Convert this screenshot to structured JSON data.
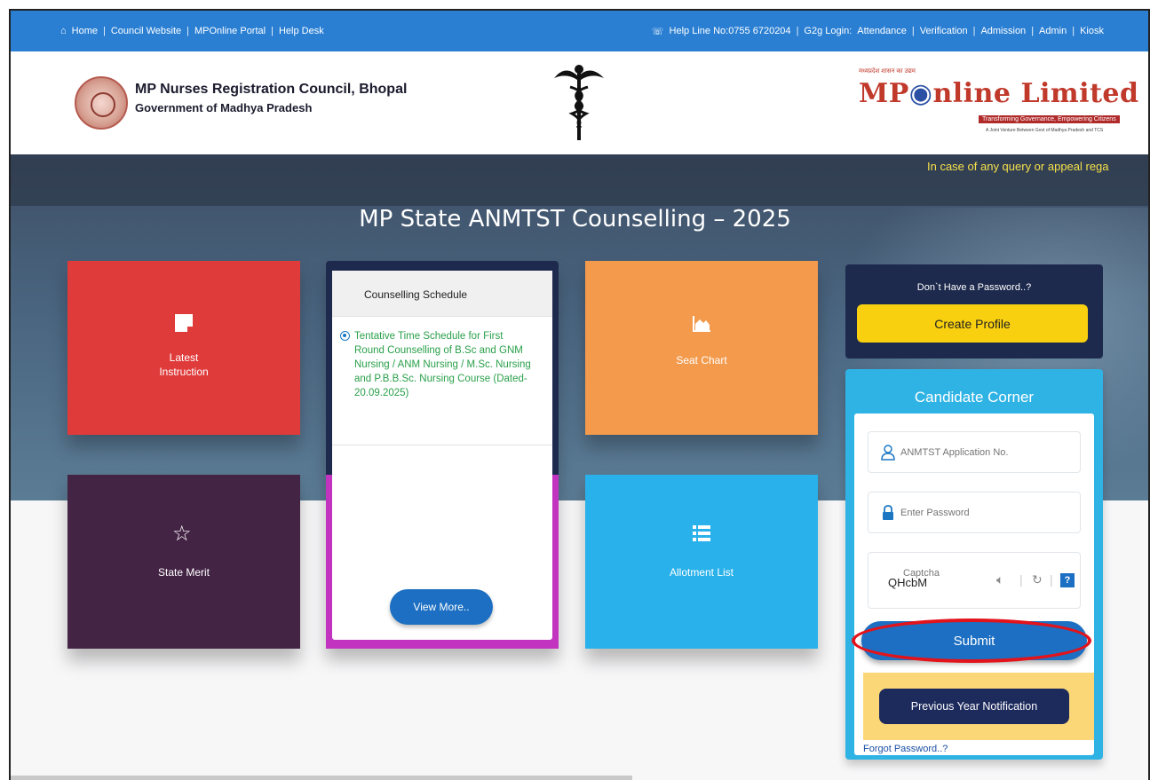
{
  "topbar": {
    "left_links": [
      "Home",
      "Council Website",
      "MPOnline Portal",
      "Help Desk"
    ],
    "right_prefix": "Help Line No:0755 6720204",
    "right_links": [
      "G2g Login:",
      "Attendance",
      "Verification",
      "Admission",
      "Admin",
      "Kiosk"
    ]
  },
  "header": {
    "org_name": "MP Nurses Registration Council, Bhopal",
    "org_sub": "Government of Madhya Pradesh",
    "partner_logo_small": "मध्यप्रदेश शासन का उद्यम",
    "partner_logo": {
      "part1": "MP",
      "part2": "nline",
      "part3": "Limited"
    },
    "partner_tagline": "Transforming Governance, Empowering Citizens",
    "partner_tagline2": "A Joint Venture Between Govt of Madhya Pradesh and TCS"
  },
  "marquee": "In case of any query or appeal rega",
  "page_title": "MP State ANMTST Counselling – 2025",
  "tiles": {
    "latest": {
      "line1": "Latest",
      "line2": "Instruction"
    },
    "seat_chart": "Seat Chart",
    "state_merit": "State Merit",
    "allotment": "Allotment List"
  },
  "schedule": {
    "heading": "Counselling Schedule",
    "item": "Tentative Time Schedule for First Round Counselling of B.Sc and GNM Nursing / ANM Nursing / M.Sc. Nursing and P.B.B.Sc. Nursing Course (Dated- 20.09.2025)",
    "view_more": "View More.."
  },
  "password_box": {
    "question": "Don`t Have a Password..?",
    "create_label": "Create Profile"
  },
  "candidate_corner": {
    "title": "Candidate Corner",
    "app_placeholder": "ANMTST Application No.",
    "password_placeholder": "Enter Password",
    "captcha_code": "QHcbM",
    "captcha_placeholder": "Captcha",
    "help_label": "?",
    "submit_label": "Submit",
    "prev_notification_label": "Previous Year Notification",
    "forgot_label": "Forgot Password..?"
  },
  "colors": {
    "topbar": "#2a7fd3",
    "tile_red": "#e03b3b",
    "tile_orange": "#f39a4c",
    "tile_purple": "#442445",
    "tile_blue": "#28b1ea",
    "navy": "#1d2a4d",
    "yellow": "#f9d00f",
    "highlight": "#e3131b"
  },
  "icons": {
    "home": "home-icon",
    "phone": "phone-icon",
    "note": "note-icon",
    "chart": "area-chart-icon",
    "star": "star-icon",
    "list": "list-icon",
    "user": "user-icon",
    "lock": "lock-icon",
    "audio": "speaker-icon",
    "refresh": "refresh-icon",
    "help": "help-icon"
  }
}
